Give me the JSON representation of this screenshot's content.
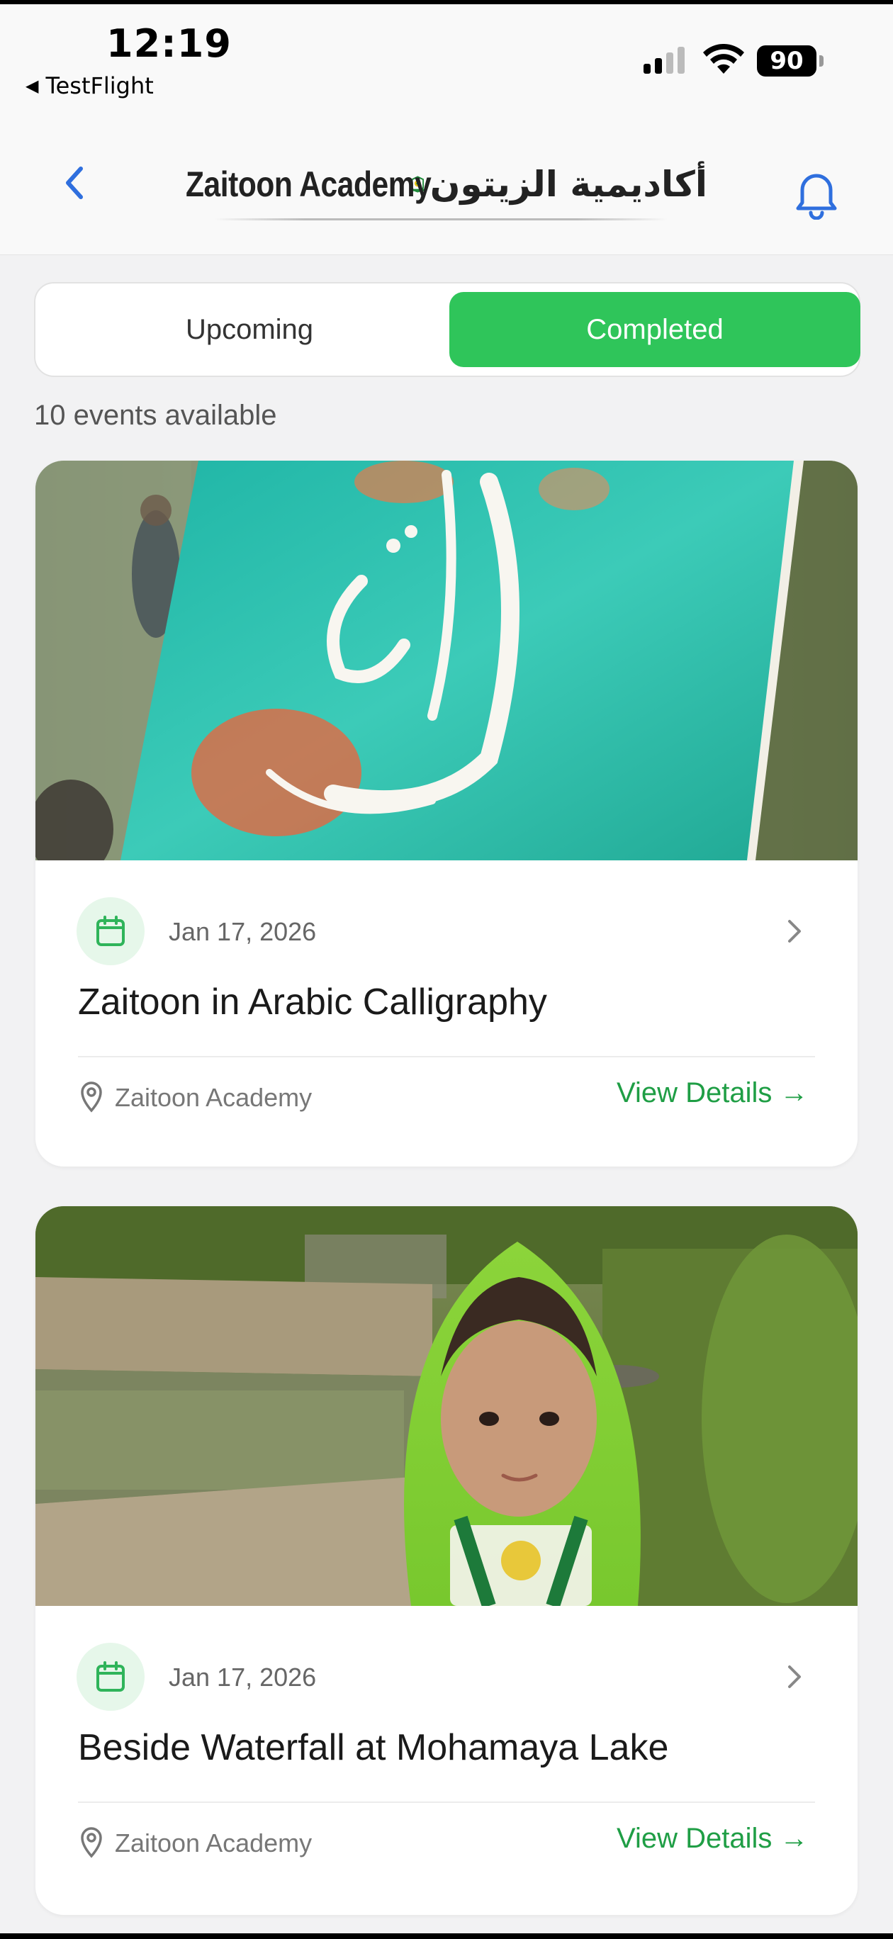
{
  "status_bar": {
    "time": "12:19",
    "back_app": "TestFlight",
    "battery": "90"
  },
  "header": {
    "logo_en": "Zaitoon Academy",
    "logo_ar": "أكاديمية الزيتون",
    "back_icon": "chevron-left-icon",
    "bell_icon": "bell-icon"
  },
  "tabs": {
    "upcoming": "Upcoming",
    "completed": "Completed",
    "active": "completed"
  },
  "events_count": "10 events available",
  "colors": {
    "accent": "#2fc55a",
    "link": "#1f9e45",
    "nav_blue": "#2f6fde"
  },
  "events": [
    {
      "date": "Jan 17, 2026",
      "title": "Zaitoon in Arabic Calligraphy",
      "location": "Zaitoon Academy",
      "action": "View Details →"
    },
    {
      "date": "Jan 17, 2026",
      "title": "Beside Waterfall at Mohamaya Lake",
      "location": "Zaitoon Academy",
      "action": "View Details →"
    }
  ]
}
